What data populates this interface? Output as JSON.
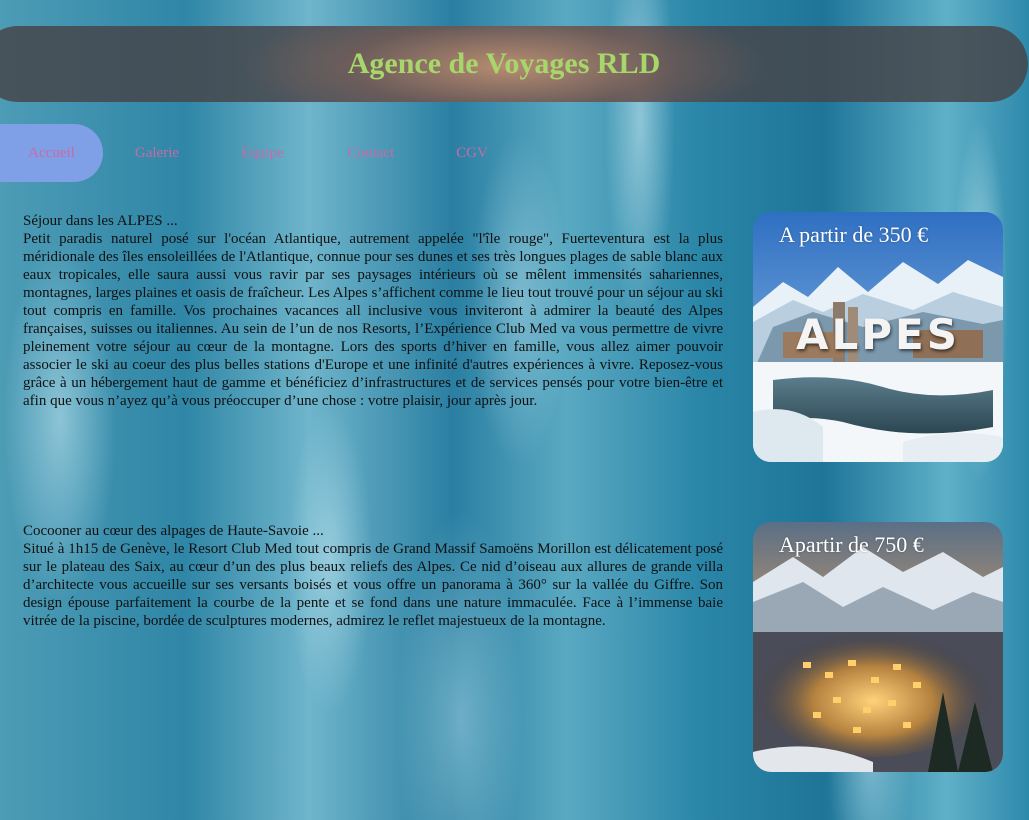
{
  "header": {
    "title": "Agence de Voyages RLD"
  },
  "nav": {
    "items": [
      {
        "label": "Accueil"
      },
      {
        "label": "Galerie"
      },
      {
        "label": "Equipe"
      },
      {
        "label": "Contact"
      },
      {
        "label": "CGV"
      }
    ],
    "active": "Accueil"
  },
  "offers": [
    {
      "title": "Séjour dans les ALPES ...",
      "text": "Petit paradis naturel posé sur l'océan Atlantique, autrement appelée \"l'île rouge\", Fuerteventura est la plus méridionale des îles ensoleillées de l'Atlantique, connue pour ses dunes et ses très longues plages de sable blanc aux eaux tropicales, elle saura aussi vous ravir par ses paysages intérieurs où se mêlent immensités sahariennes, montagnes, larges plaines et oasis de fraîcheur. Les Alpes s’affichent comme le lieu tout trouvé pour un séjour au ski tout compris en famille. Vos prochaines vacances all inclusive vous inviteront à admirer la beauté des Alpes françaises, suisses ou italiennes. Au sein de l’un de nos Resorts, l’Expérience Club Med va vous permettre de vivre pleinement votre séjour au cœur de la montagne. Lors des sports d’hiver en famille, vous allez aimer pouvoir associer le ski au coeur des plus belles stations d'Europe et une infinité d'autres expériences à vivre. Reposez-vous grâce à un hébergement haut de gamme et bénéficiez d’infrastructures et de services pensés pour votre bien-être et afin que vous n’ayez qu’à vous préoccuper d’une chose : votre plaisir, jour après jour.",
      "price": "A partir de 350 €",
      "image_label": "ALPES"
    },
    {
      "title": "Cocooner au cœur des alpages de Haute-Savoie ...",
      "text": "Situé à 1h15 de Genève, le Resort Club Med tout compris de Grand Massif Samoëns Morillon est délicatement posé sur le plateau des Saix, au cœur d’un des plus beaux reliefs des Alpes. Ce nid d’oiseau aux allures de grande villa d’architecte vous accueille sur ses versants boisés et vous offre un panorama à 360° sur la vallée du Giffre. Son design épouse parfaitement la courbe de la pente et se fond dans une nature immaculée. Face à l’immense baie vitrée de la piscine, bordée de sculptures modernes, admirez le reflet majestueux de la montagne.",
      "price": "Apartir de 750 €"
    }
  ]
}
